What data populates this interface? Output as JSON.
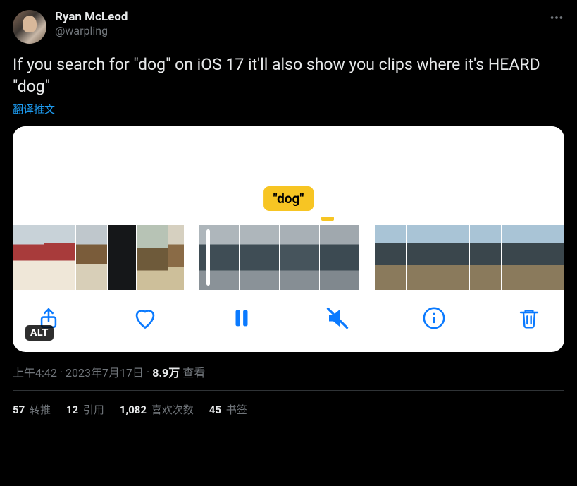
{
  "author": {
    "display_name": "Ryan McLeod",
    "handle": "@warpling"
  },
  "tweet_text": "If you search for \"dog\" on iOS 17 it'll also show you clips where it's HEARD \"dog\"",
  "translate_label": "翻译推文",
  "media": {
    "search_tag": "\"dog\"",
    "alt_label": "ALT"
  },
  "timestamp": {
    "time": "上午4:42",
    "sep": " · ",
    "date": "2023年7月17日",
    "views_count": "8.9万",
    "views_label": " 查看"
  },
  "stats": {
    "retweets": {
      "count": "57",
      "label": " 转推"
    },
    "quotes": {
      "count": "12",
      "label": " 引用"
    },
    "likes": {
      "count": "1,082",
      "label": " 喜欢次数"
    },
    "bookmarks": {
      "count": "45",
      "label": " 书签"
    }
  }
}
